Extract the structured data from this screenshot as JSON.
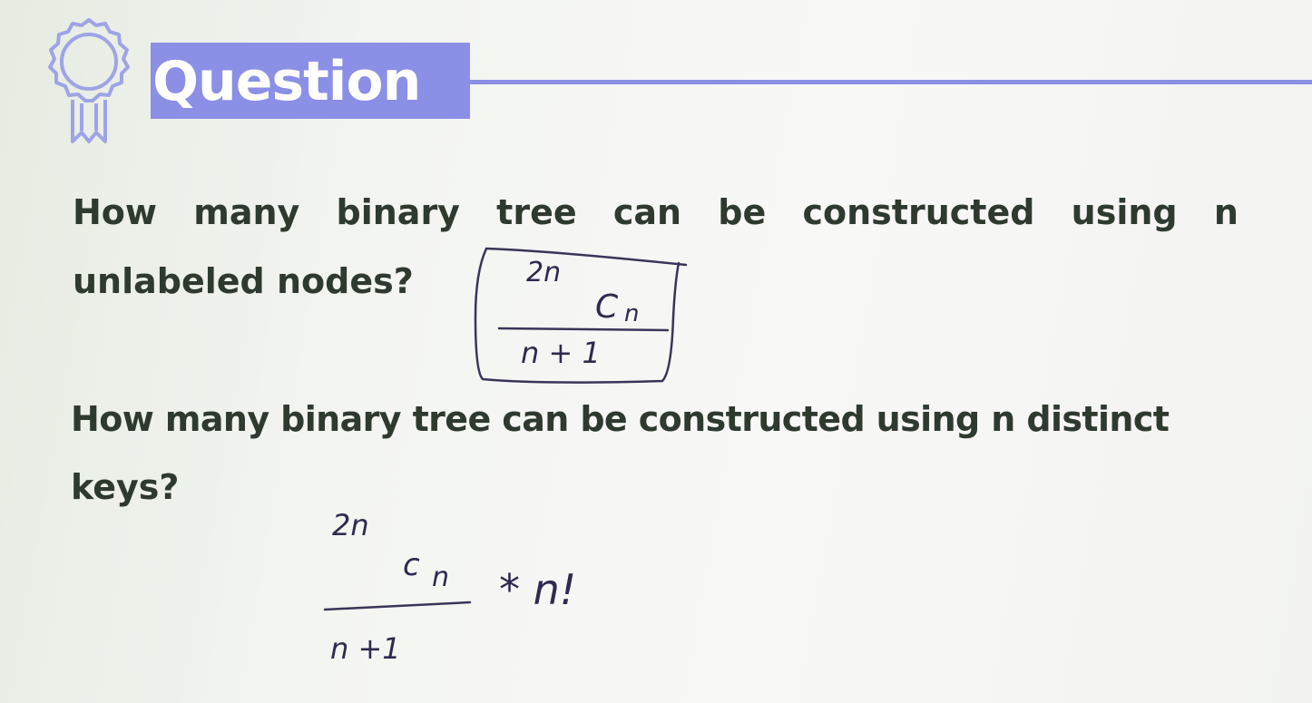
{
  "header": {
    "title": "Question",
    "icon": "award-ribbon-icon"
  },
  "questions": [
    {
      "line1_words": [
        "How",
        "many",
        "binary",
        "tree",
        "can",
        "be",
        "constructed",
        "using",
        "n"
      ],
      "line2": "unlabeled nodes?",
      "answer": {
        "numerator_sup": "2n",
        "numerator_base": "C",
        "numerator_sub": "n",
        "denominator": "n + 1",
        "boxed": true
      }
    },
    {
      "line1": "How many binary tree can be constructed using n distinct",
      "line2": "keys?",
      "answer": {
        "numerator_sup": "2n",
        "numerator_base": "c",
        "numerator_sub": "n",
        "denominator": "n +1",
        "multiplier": "* n!",
        "boxed": false
      }
    }
  ],
  "colors": {
    "accent": "#8b8fe6",
    "text": "#2f3a2f",
    "ink": "#2e2a4f"
  }
}
